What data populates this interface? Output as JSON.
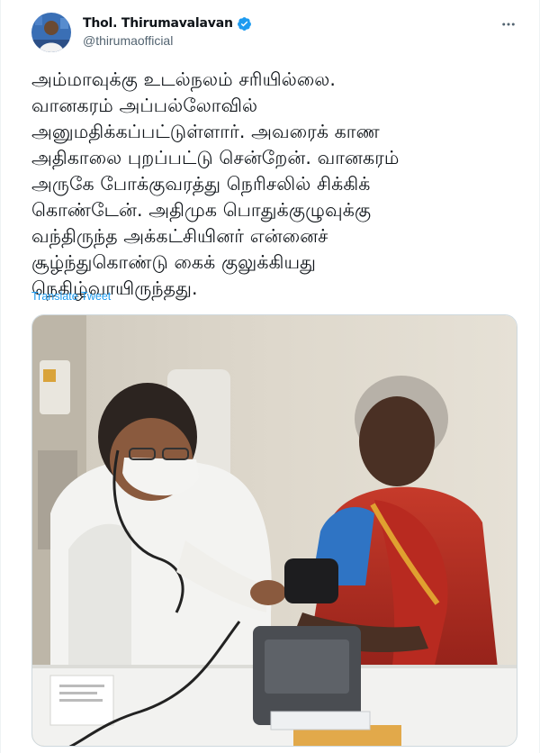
{
  "author": {
    "display_name": "Thol. Thirumavalavan",
    "handle": "@thirumaofficial",
    "verified": true
  },
  "icons": {
    "verified": "verified-badge-icon",
    "more": "more-options-icon"
  },
  "tweet": {
    "lines": [
      "அம்மாவுக்கு உடல்நலம் சரியில்லை.",
      "வானகரம் அப்பல்லோவில்",
      "அனுமதிக்கப்பட்டுள்ளார். அவரைக் காண",
      "அதிகாலை புறப்பட்டு சென்றேன். வானகரம்",
      "அருகே போக்குவரத்து நெரிசலில் சிக்கிக்",
      "கொண்டேன். அதிமுக பொதுக்குழுவுக்கு",
      "வந்திருந்த அக்கட்சியினர் என்னைச்",
      "சூழ்ந்துகொண்டு கைக் குலுக்கியது",
      "நெகிழ்வாயிருந்தது."
    ],
    "translate_label": "Translate Tweet"
  },
  "colors": {
    "accent": "#1d9bf0",
    "text_primary": "#0f1419",
    "text_secondary": "#536471"
  }
}
